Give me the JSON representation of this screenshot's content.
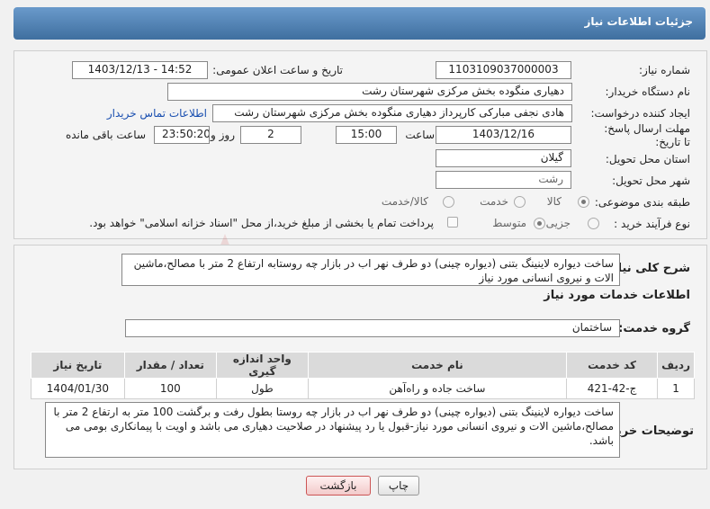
{
  "header": {
    "title": "جزئیات اطلاعات نیاز"
  },
  "form": {
    "need_number_label": "شماره نیاز:",
    "need_number": "1103109037000003",
    "announce_label": "تاریخ و ساعت اعلان عمومی:",
    "announce_value": "1403/12/13 - 14:52",
    "buyer_org_label": "نام دستگاه خریدار:",
    "buyer_org": "دهیاری منگوده بخش مرکزی شهرستان رشت",
    "creator_label": "ایجاد کننده درخواست:",
    "creator": "هادی نجفی مبارکی کارپرداز دهیاری منگوده بخش مرکزی شهرستان رشت",
    "contact_link": "اطلاعات تماس خریدار",
    "deadline_label": "مهلت ارسال پاسخ: تا تاریخ:",
    "deadline_date": "1403/12/16",
    "time_label": "ساعت",
    "deadline_time": "15:00",
    "days_value": "2",
    "days_label": "روز و",
    "remaining_time": "23:50:20",
    "remaining_label": "ساعت باقی مانده",
    "province_label": "استان محل تحویل:",
    "province": "گیلان",
    "city_label": "شهر محل تحویل:",
    "city": "رشت",
    "category_label": "طبقه بندی موضوعی:",
    "category_options": [
      "کالا",
      "خدمت",
      "کالا/خدمت"
    ],
    "process_label": "نوع فرآیند خرید :",
    "process_options": [
      "جزیی",
      "متوسط"
    ],
    "payment_note": "پرداخت تمام یا بخشی از مبلغ خرید،از محل \"اسناد خزانه اسلامی\" خواهد بود."
  },
  "summary": {
    "label": "شرح کلی نیاز:",
    "text": "ساخت دیواره لاینینگ بتنی (دیواره چینی) دو طرف نهر اب در بازار چه روستابه ارتفاع 2 متر با مصالح،ماشین الات و نیروی انسانی مورد نیاز"
  },
  "services": {
    "section_title": "اطلاعات خدمات مورد نیاز",
    "group_label": "گروه خدمت:",
    "group_value": "ساختمان",
    "columns": [
      "ردیف",
      "کد خدمت",
      "نام خدمت",
      "واحد اندازه گیری",
      "تعداد / مقدار",
      "تاریخ نیاز"
    ],
    "rows": [
      {
        "row": "1",
        "code": "ج-42-421",
        "name": "ساخت جاده و راه‌آهن",
        "unit": "طول",
        "qty": "100",
        "date": "1404/01/30"
      }
    ]
  },
  "buyer_notes": {
    "label": "توضیحات خریدار:",
    "text": "ساخت دیواره لاینینگ بتنی (دیواره چینی) دو طرف نهر اب در بازار چه روستا بطول رفت و برگشت 100 متر به ارتفاع 2 متر با مصالح،ماشین الات و نیروی انسانی مورد نیاز-قبول یا رد پیشنهاد در صلاحیت دهیاری می باشد و اویت با پیمانکاری بومی می باشد."
  },
  "buttons": {
    "print": "چاپ",
    "back": "بازگشت"
  },
  "watermark": {
    "text": "AriaTender.neT"
  }
}
